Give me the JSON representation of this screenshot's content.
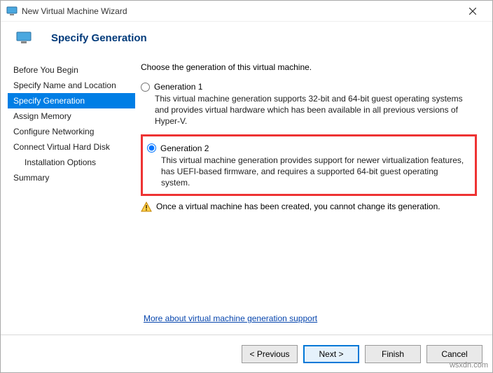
{
  "window": {
    "title": "New Virtual Machine Wizard"
  },
  "header": {
    "title": "Specify Generation"
  },
  "sidebar": {
    "items": [
      {
        "label": "Before You Begin",
        "active": false,
        "indent": false
      },
      {
        "label": "Specify Name and Location",
        "active": false,
        "indent": false
      },
      {
        "label": "Specify Generation",
        "active": true,
        "indent": false
      },
      {
        "label": "Assign Memory",
        "active": false,
        "indent": false
      },
      {
        "label": "Configure Networking",
        "active": false,
        "indent": false
      },
      {
        "label": "Connect Virtual Hard Disk",
        "active": false,
        "indent": false
      },
      {
        "label": "Installation Options",
        "active": false,
        "indent": true
      },
      {
        "label": "Summary",
        "active": false,
        "indent": false
      }
    ]
  },
  "content": {
    "intro": "Choose the generation of this virtual machine.",
    "gen1_label": "Generation 1",
    "gen1_desc": "This virtual machine generation supports 32-bit and 64-bit guest operating systems and provides virtual hardware which has been available in all previous versions of Hyper-V.",
    "gen2_label": "Generation 2",
    "gen2_desc": "This virtual machine generation provides support for newer virtualization features, has UEFI-based firmware, and requires a supported 64-bit guest operating system.",
    "warning": "Once a virtual machine has been created, you cannot change its generation.",
    "link": "More about virtual machine generation support"
  },
  "footer": {
    "previous": "< Previous",
    "next": "Next >",
    "finish": "Finish",
    "cancel": "Cancel"
  },
  "watermark": "wsxdn.com"
}
